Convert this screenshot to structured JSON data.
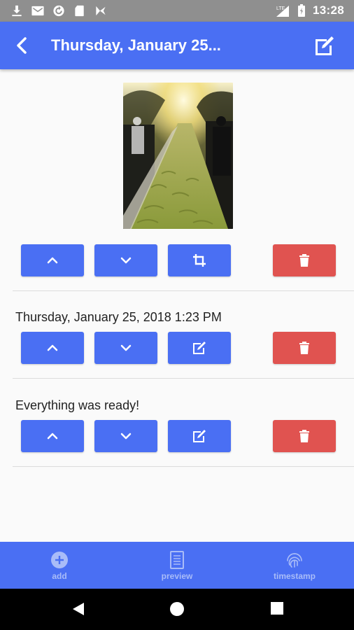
{
  "status_bar": {
    "time": "13:28",
    "network": "LTE",
    "icons": [
      "download-icon",
      "gmail-icon",
      "sync-icon",
      "sd-card-icon",
      "play-store-icon"
    ]
  },
  "app_bar": {
    "title": "Thursday, January 25...",
    "back_icon": "back-chevron-icon",
    "edit_icon": "edit-note-icon"
  },
  "blocks": [
    {
      "type": "image",
      "alt": "photo",
      "actions": [
        "move-up-icon",
        "move-down-icon",
        "crop-icon",
        "delete-icon"
      ]
    },
    {
      "type": "text",
      "text": "Thursday, January 25, 2018 1:23 PM",
      "actions": [
        "move-up-icon",
        "move-down-icon",
        "edit-icon",
        "delete-icon"
      ]
    },
    {
      "type": "text",
      "text": "Everything was ready!",
      "actions": [
        "move-up-icon",
        "move-down-icon",
        "edit-icon",
        "delete-icon"
      ]
    }
  ],
  "bottom_nav": [
    {
      "label": "add",
      "icon": "add-circle-icon"
    },
    {
      "label": "preview",
      "icon": "document-icon"
    },
    {
      "label": "timestamp",
      "icon": "fingerprint-icon"
    }
  ],
  "colors": {
    "primary": "#4a6ff3",
    "danger": "#e05350",
    "status_bar": "#8f8f8f",
    "nav_label": "#a9bcf8"
  }
}
